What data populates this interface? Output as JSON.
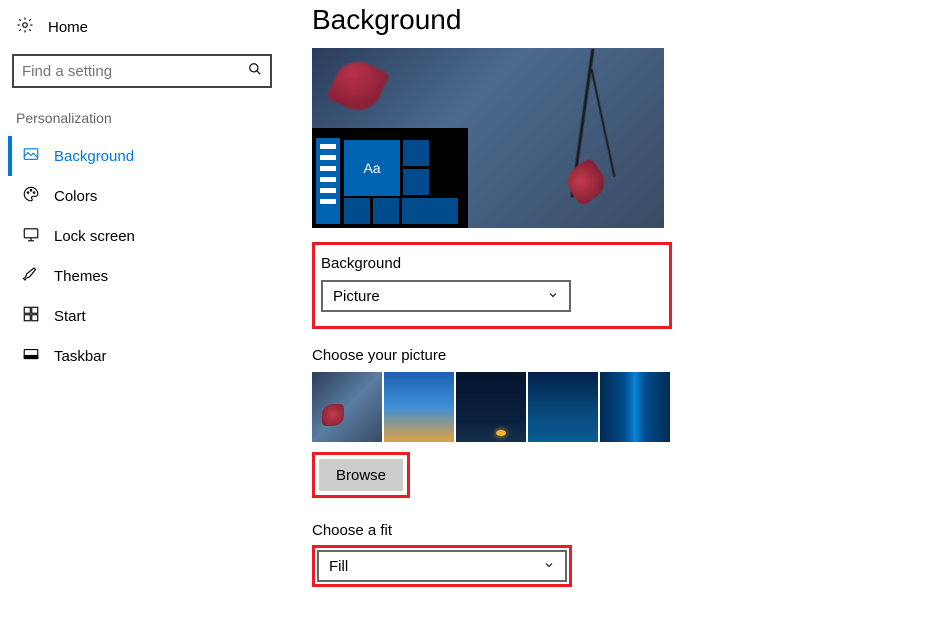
{
  "sidebar": {
    "home_label": "Home",
    "search_placeholder": "Find a setting",
    "section_title": "Personalization",
    "items": [
      {
        "label": "Background",
        "selected": true
      },
      {
        "label": "Colors",
        "selected": false
      },
      {
        "label": "Lock screen",
        "selected": false
      },
      {
        "label": "Themes",
        "selected": false
      },
      {
        "label": "Start",
        "selected": false
      },
      {
        "label": "Taskbar",
        "selected": false
      }
    ]
  },
  "main": {
    "page_title": "Background",
    "preview_tile_text": "Aa",
    "background": {
      "label": "Background",
      "value": "Picture"
    },
    "choose_picture": {
      "label": "Choose your picture",
      "browse_label": "Browse"
    },
    "choose_fit": {
      "label": "Choose a fit",
      "value": "Fill"
    }
  }
}
